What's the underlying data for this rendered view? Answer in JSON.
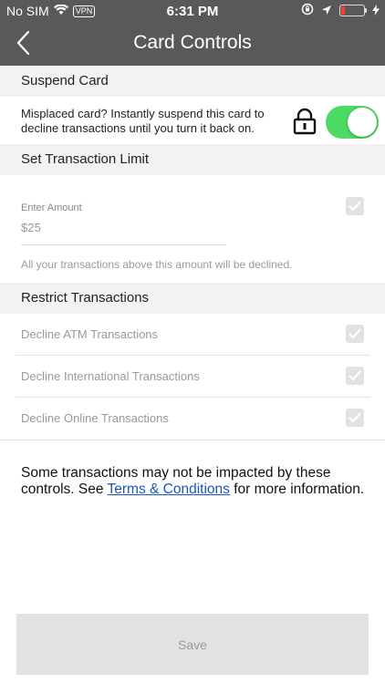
{
  "status_bar": {
    "carrier": "No SIM",
    "vpn": "VPN",
    "time": "6:31 PM"
  },
  "header": {
    "title": "Card Controls"
  },
  "suspend": {
    "heading": "Suspend Card",
    "description": "Misplaced card? Instantly suspend this card to decline transactions until you turn it back on.",
    "toggle_on": true
  },
  "limit": {
    "heading": "Set Transaction Limit",
    "amount_label": "Enter Amount",
    "amount_value": "$25",
    "note": "All your transactions above this amount will be declined."
  },
  "restrict": {
    "heading": "Restrict Transactions",
    "items": [
      {
        "label": "Decline ATM Transactions"
      },
      {
        "label": "Decline International Transactions"
      },
      {
        "label": "Decline Online Transactions"
      }
    ]
  },
  "footer": {
    "text_before": "Some transactions may not be impacted by these controls. See ",
    "link": "Terms & Conditions",
    "text_after": " for more information."
  },
  "save_label": "Save",
  "colors": {
    "header": "#595959",
    "toggle": "#4cd964",
    "link": "#1a56b8",
    "section": "#f2f2f2"
  }
}
